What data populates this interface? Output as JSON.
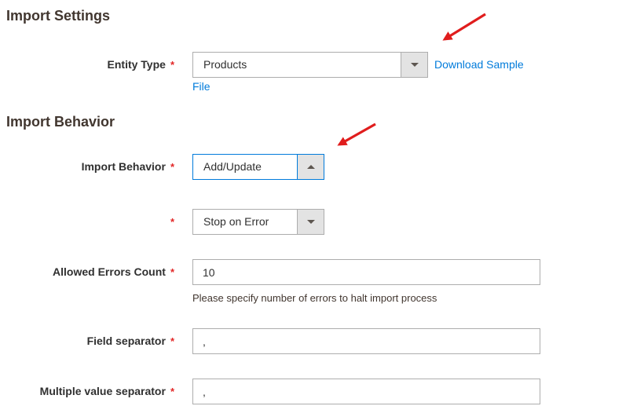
{
  "ui": {
    "required_marker": "*"
  },
  "colors": {
    "heading_text": "#41362f",
    "body_text": "#303030",
    "link_blue": "#007bdb",
    "focus_border_blue": "#007bdb",
    "input_border_gray": "#adadad",
    "caret_button_gray": "#e3e3e3",
    "asterisk_red": "#e22626",
    "annotation_arrow_red": "#e01d1d"
  },
  "import_settings": {
    "heading": "Import Settings",
    "entity_type": {
      "label": "Entity Type",
      "value": "Products",
      "download_link_line1": "Download Sample",
      "download_link_line2": "File"
    }
  },
  "import_behavior": {
    "heading": "Import Behavior",
    "behavior": {
      "label": "Import Behavior",
      "value": "Add/Update"
    },
    "on_error": {
      "value": "Stop on Error"
    },
    "allowed_errors": {
      "label": "Allowed Errors Count",
      "value": "10",
      "note": "Please specify number of errors to halt import process"
    },
    "field_separator": {
      "label": "Field separator",
      "value": ","
    },
    "multiple_value_separator": {
      "label": "Multiple value separator",
      "value": ","
    }
  }
}
